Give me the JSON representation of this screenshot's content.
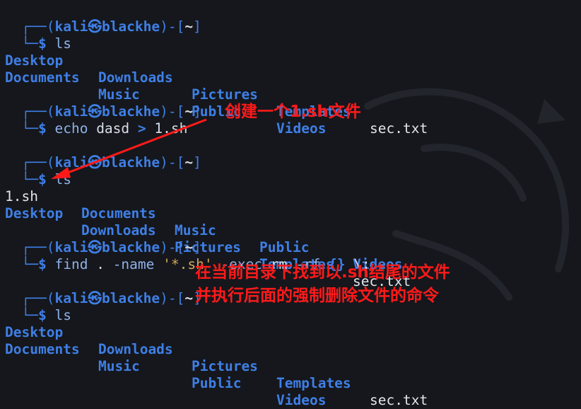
{
  "prompt": {
    "top_left": "┌──(",
    "user": "kali",
    "at": "㉿",
    "host": "blackhe",
    "close": ")-[",
    "path": "~",
    "end": "]",
    "bottom": "└─",
    "dollar": "$"
  },
  "blocks": [
    {
      "command": "ls",
      "rows": [
        [
          {
            "text": "Desktop",
            "type": "dir"
          },
          {
            "text": "Downloads",
            "type": "dir"
          },
          {
            "text": "Pictures",
            "type": "dir"
          },
          {
            "text": "Templates",
            "type": "dir"
          },
          {
            "text": "sec.txt",
            "type": "file"
          }
        ],
        [
          {
            "text": "Documents",
            "type": "dir"
          },
          {
            "text": "Music",
            "type": "dir"
          },
          {
            "text": "Public",
            "type": "dir"
          },
          {
            "text": "Videos",
            "type": "dir"
          }
        ]
      ]
    },
    {
      "command_parts": [
        "echo",
        "dasd",
        ">",
        "1.sh"
      ]
    },
    {
      "command": "ls",
      "rows": [
        [
          {
            "text": "1.sh",
            "type": "file"
          },
          {
            "text": "Documents",
            "type": "dir"
          },
          {
            "text": "Music",
            "type": "dir"
          },
          {
            "text": "Public",
            "type": "dir"
          },
          {
            "text": "Videos",
            "type": "dir"
          }
        ],
        [
          {
            "text": "Desktop",
            "type": "dir"
          },
          {
            "text": "Downloads",
            "type": "dir"
          },
          {
            "text": "Pictures",
            "type": "dir"
          },
          {
            "text": "Templates",
            "type": "dir"
          },
          {
            "text": "sec.txt",
            "type": "file"
          }
        ]
      ]
    },
    {
      "command_parts": [
        "find",
        ".",
        "-name",
        "'*.sh'",
        "-exec",
        "rm",
        "-rf",
        "{}",
        "\\;"
      ]
    },
    {
      "command": "ls",
      "rows": [
        [
          {
            "text": "Desktop",
            "type": "dir"
          },
          {
            "text": "Downloads",
            "type": "dir"
          },
          {
            "text": "Pictures",
            "type": "dir"
          },
          {
            "text": "Templates",
            "type": "dir"
          },
          {
            "text": "sec.txt",
            "type": "file"
          }
        ],
        [
          {
            "text": "Documents",
            "type": "dir"
          },
          {
            "text": "Music",
            "type": "dir"
          },
          {
            "text": "Public",
            "type": "dir"
          },
          {
            "text": "Videos",
            "type": "dir"
          }
        ]
      ]
    }
  ],
  "annotations": {
    "create_file": "创建一个1.sh文件",
    "find_line1": "在当前目录下找到以.sh结尾的文件",
    "find_line2": "并执行后面的强制删除文件的命令"
  },
  "colors": {
    "background": "#15171c",
    "directory": "#3f7fe6",
    "annotation": "#ff1a1a",
    "string": "#d6a85c"
  }
}
